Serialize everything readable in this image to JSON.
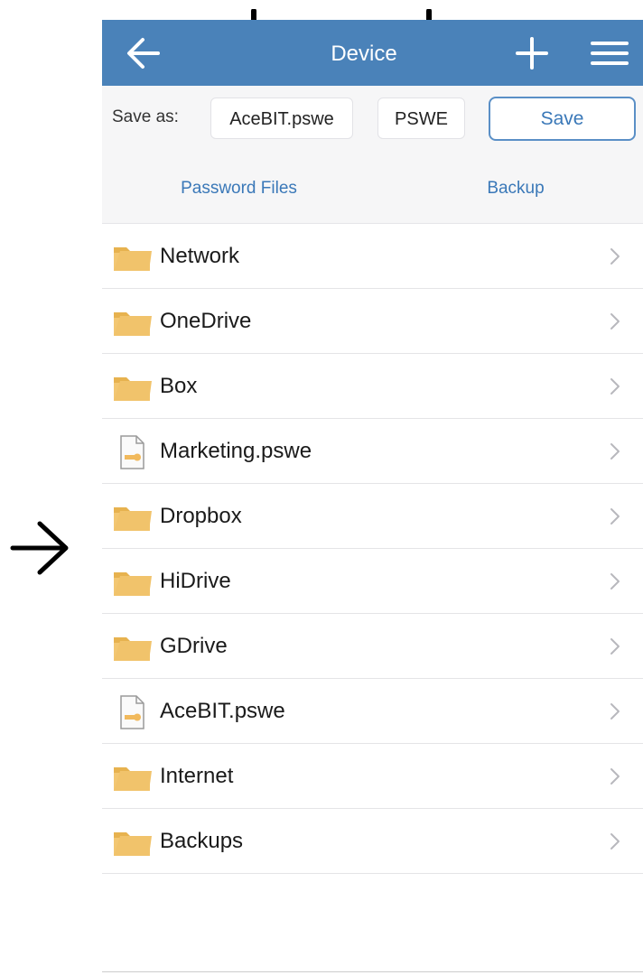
{
  "navbar": {
    "title": "Device",
    "back_icon": "arrow-left-icon",
    "add_icon": "plus-icon",
    "menu_icon": "hamburger-menu-icon",
    "background": "#4a82b9"
  },
  "save_bar": {
    "label": "Save as:",
    "filename_value": "AceBIT.pswe",
    "extension_value": "PSWE",
    "save_label": "Save"
  },
  "tabs": [
    {
      "label": "Password Files"
    },
    {
      "label": "Backup"
    }
  ],
  "files": [
    {
      "name": "Network",
      "type": "folder"
    },
    {
      "name": "OneDrive",
      "type": "folder"
    },
    {
      "name": "Box",
      "type": "folder"
    },
    {
      "name": "Marketing.pswe",
      "type": "file"
    },
    {
      "name": "Dropbox",
      "type": "folder"
    },
    {
      "name": "HiDrive",
      "type": "folder"
    },
    {
      "name": "GDrive",
      "type": "folder"
    },
    {
      "name": "AceBIT.pswe",
      "type": "file"
    },
    {
      "name": "Internet",
      "type": "folder"
    },
    {
      "name": "Backups",
      "type": "folder"
    }
  ],
  "colors": {
    "accent": "#4a82b9",
    "link": "#3a78b8",
    "folder": "#f1c36b"
  }
}
